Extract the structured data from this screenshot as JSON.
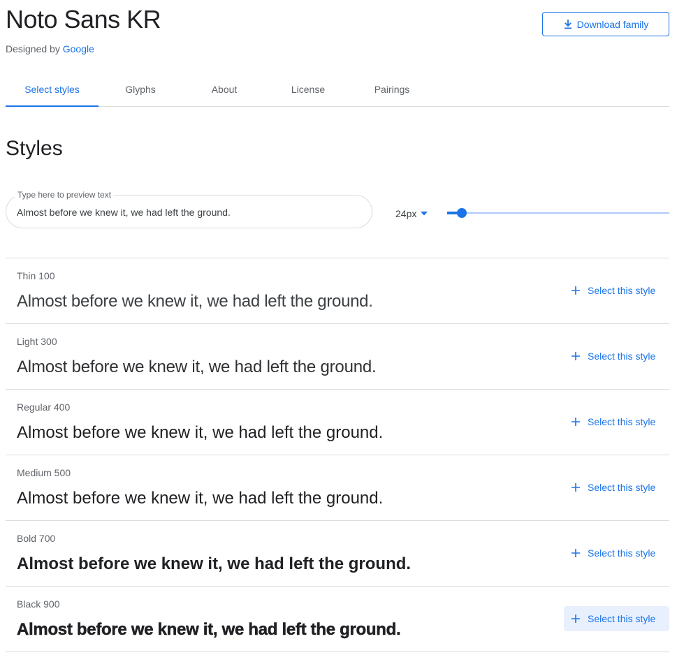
{
  "header": {
    "family_name": "Noto Sans KR",
    "designed_by_prefix": "Designed by ",
    "designer": "Google",
    "download_label": "Download family"
  },
  "tabs": [
    {
      "label": "Select styles",
      "active": true
    },
    {
      "label": "Glyphs",
      "active": false
    },
    {
      "label": "About",
      "active": false
    },
    {
      "label": "License",
      "active": false
    },
    {
      "label": "Pairings",
      "active": false
    }
  ],
  "styles_section": {
    "title": "Styles",
    "preview": {
      "label": "Type here to preview text",
      "value": "Almost before we knew it, we had left the ground."
    },
    "size": {
      "selected": "24px",
      "slider_fraction": 0.065
    }
  },
  "style_rows": [
    {
      "name": "Thin 100",
      "weight": 100,
      "sample": "Almost before we knew it, we had left the ground.",
      "button": "Select this style",
      "hovered": false
    },
    {
      "name": "Light 300",
      "weight": 300,
      "sample": "Almost before we knew it, we had left the ground.",
      "button": "Select this style",
      "hovered": false
    },
    {
      "name": "Regular 400",
      "weight": 400,
      "sample": "Almost before we knew it, we had left the ground.",
      "button": "Select this style",
      "hovered": false
    },
    {
      "name": "Medium 500",
      "weight": 500,
      "sample": "Almost before we knew it, we had left the ground.",
      "button": "Select this style",
      "hovered": false
    },
    {
      "name": "Bold 700",
      "weight": 700,
      "sample": "Almost before we knew it, we had left the ground.",
      "button": "Select this style",
      "hovered": false
    },
    {
      "name": "Black 900",
      "weight": 900,
      "sample": "Almost before we knew it, we had left the ground.",
      "button": "Select this style",
      "hovered": true
    }
  ],
  "colors": {
    "accent": "#1a73e8",
    "text": "#202124",
    "muted": "#5f6368",
    "divider": "#dadce0",
    "hover_bg": "#e8f0fe"
  },
  "icons": {
    "download": "download-icon",
    "dropdown": "caret-down-icon",
    "add": "plus-icon"
  }
}
